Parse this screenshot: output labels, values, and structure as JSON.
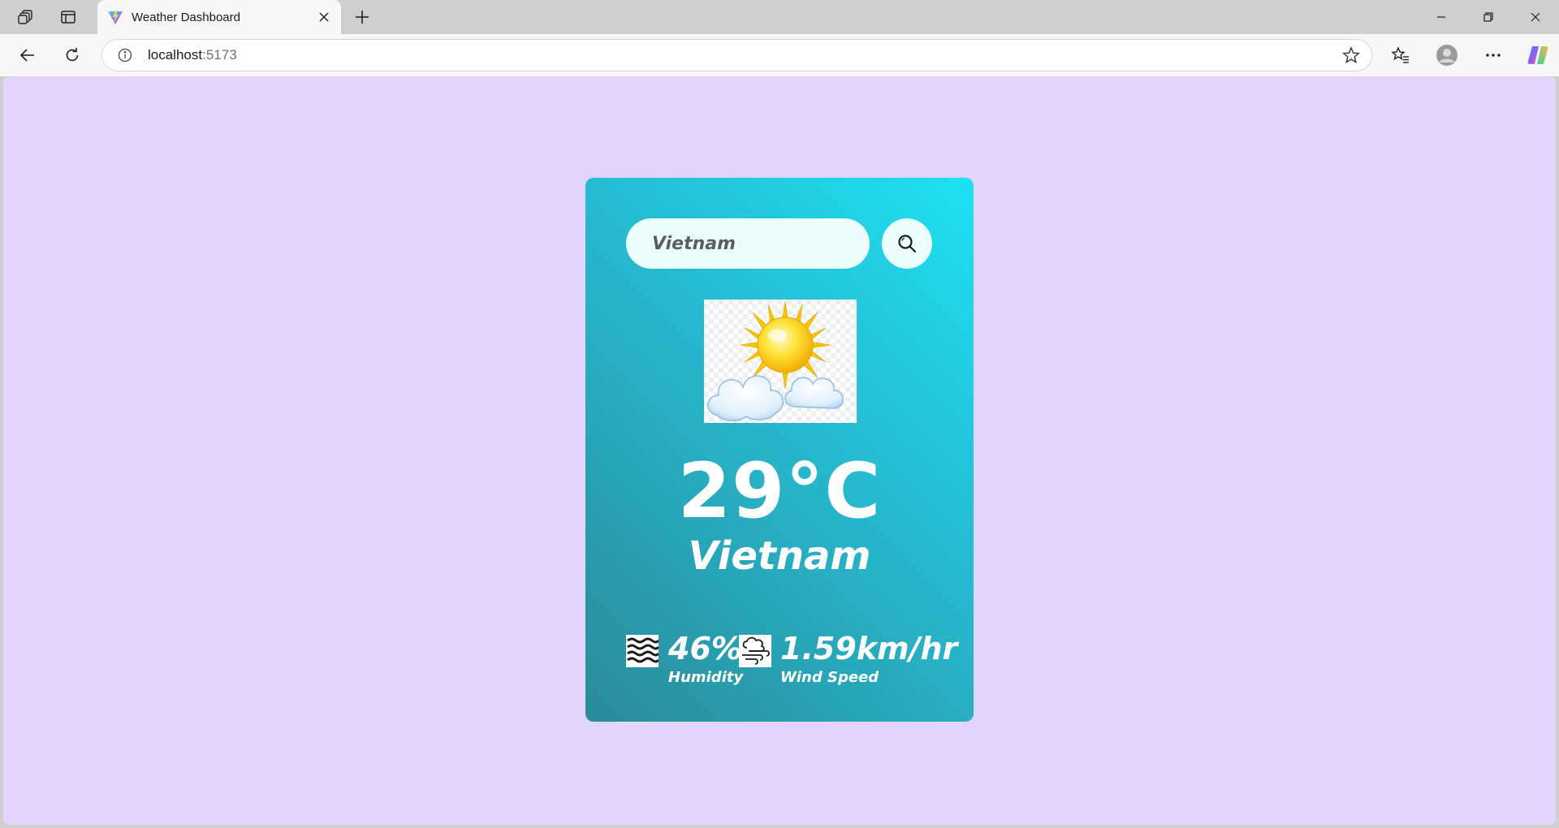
{
  "browser": {
    "tab": {
      "title": "Weather Dashboard"
    },
    "address": {
      "host": "localhost",
      "port": ":5173"
    }
  },
  "app": {
    "search": {
      "value": "Vietnam"
    },
    "weather": {
      "icon": "sun-behind-clouds-icon",
      "temperature": "29°C",
      "city": "Vietnam",
      "humidity_value": "46%",
      "humidity_label": "Humidity",
      "wind_value": "1.59km/hr",
      "wind_label": "Wind Speed"
    }
  },
  "colors": {
    "background": "#e3d4fc",
    "card_gradient_start": "#1ee0f4",
    "card_gradient_end": "#2a8b9a",
    "input_bg": "#ebfffc"
  }
}
